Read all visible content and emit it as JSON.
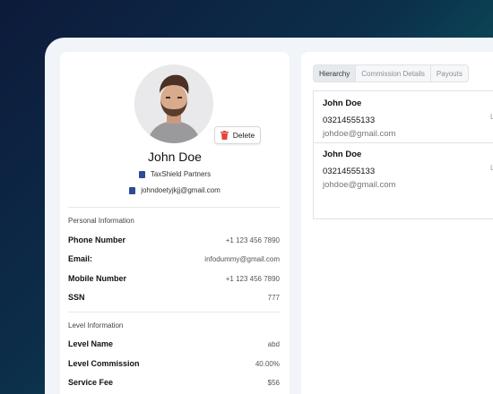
{
  "profile": {
    "name": "John Doe",
    "delete_label": "Delete",
    "company": "TaxShield Partners",
    "email": "johndoetyjkjj@gmail.com"
  },
  "personal": {
    "title": "Personal Information",
    "rows": [
      {
        "label": "Phone Number",
        "value": "+1 123 456 7890"
      },
      {
        "label": "Email:",
        "value": "infodummy@gmail.com"
      },
      {
        "label": "Mobile Number",
        "value": "+1 123 456 7890"
      },
      {
        "label": "SSN",
        "value": "777"
      }
    ]
  },
  "level": {
    "title": "Level Information",
    "rows": [
      {
        "label": "Level Name",
        "value": "abd"
      },
      {
        "label": "Level Commission",
        "value": "40.00%"
      },
      {
        "label": "Service Fee",
        "value": "$56"
      }
    ]
  },
  "tabs": [
    "Hierarchy",
    "Commission Details",
    "Payouts"
  ],
  "hierarchy": [
    {
      "name": "John Doe",
      "phone": "03214555133",
      "email": "johdoe@gmail.com",
      "trailing": "L"
    },
    {
      "name": "John Doe",
      "phone": "03214555133",
      "email": "johdoe@gmail.com",
      "trailing": "L"
    }
  ],
  "colors": {
    "accent_delete": "#e0463f",
    "meta_icon": "#2d4b9a"
  }
}
